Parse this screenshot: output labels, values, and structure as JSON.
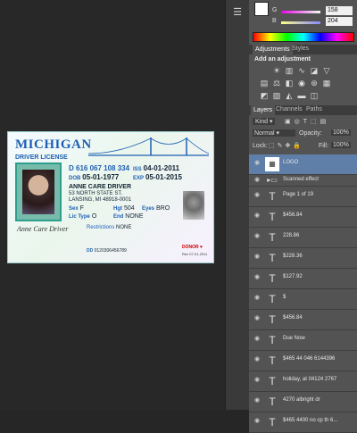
{
  "color_panel": {
    "g_label": "G",
    "g_value": "158",
    "b_label": "B",
    "b_value": "204"
  },
  "adjustments": {
    "tab_active": "Adjustments",
    "tab_other": "Styles",
    "title": "Add an adjustment"
  },
  "layers": {
    "tabs": [
      "Layers",
      "Channels",
      "Paths"
    ],
    "kind_label": "Kind",
    "blend_mode": "Normal",
    "opacity_label": "Opacity:",
    "opacity_value": "100%",
    "lock_label": "Lock:",
    "fill_label": "Fill:",
    "fill_value": "100%",
    "items": [
      {
        "name": "LOGO",
        "type": "image"
      },
      {
        "name": "Scanned effect",
        "type": "folder"
      },
      {
        "name": "Page 1 of 19",
        "type": "text"
      },
      {
        "name": "$456.84",
        "type": "text"
      },
      {
        "name": "228.86",
        "type": "text"
      },
      {
        "name": "$228.36",
        "type": "text"
      },
      {
        "name": "$127.92",
        "type": "text"
      },
      {
        "name": "$",
        "type": "text"
      },
      {
        "name": "$456.84",
        "type": "text"
      },
      {
        "name": "Due Now",
        "type": "text"
      },
      {
        "name": "$465 44 046 6144396",
        "type": "text"
      },
      {
        "name": "holiday, at 04124 2767",
        "type": "text"
      },
      {
        "name": "4270 albright dr",
        "type": "text"
      },
      {
        "name": "$465 4400 no cp th 6...",
        "type": "text"
      }
    ]
  },
  "card": {
    "state": "MICHIGAN",
    "type_label": "DRIVER LICENSE",
    "dl_number": "D 616 067 108 334",
    "dob_label": "DOB",
    "dob": "05-01-1977",
    "iss_label": "ISS",
    "iss": "04-01-2011",
    "exp_label": "EXP",
    "exp": "05-01-2015",
    "name": "ANNE CARE DRIVER",
    "address1": "53 NORTH STATE ST.",
    "address2": "LANSING, MI 48918-0001",
    "sex_label": "Sex",
    "sex": "F",
    "hgt_label": "Hgt",
    "hgt": "504",
    "eyes_label": "Eyes",
    "eyes": "BRO",
    "lic_type_label": "Lic Type",
    "lic_type": "O",
    "end_label": "End",
    "end": "NONE",
    "restrictions_label": "Restrictions",
    "restrictions": "NONE",
    "signature": "Anne Care Driver",
    "dd_label": "DD",
    "dd": "0120306456789",
    "donor": "DONOR",
    "donor_date": "Rev 07-01-2011"
  }
}
